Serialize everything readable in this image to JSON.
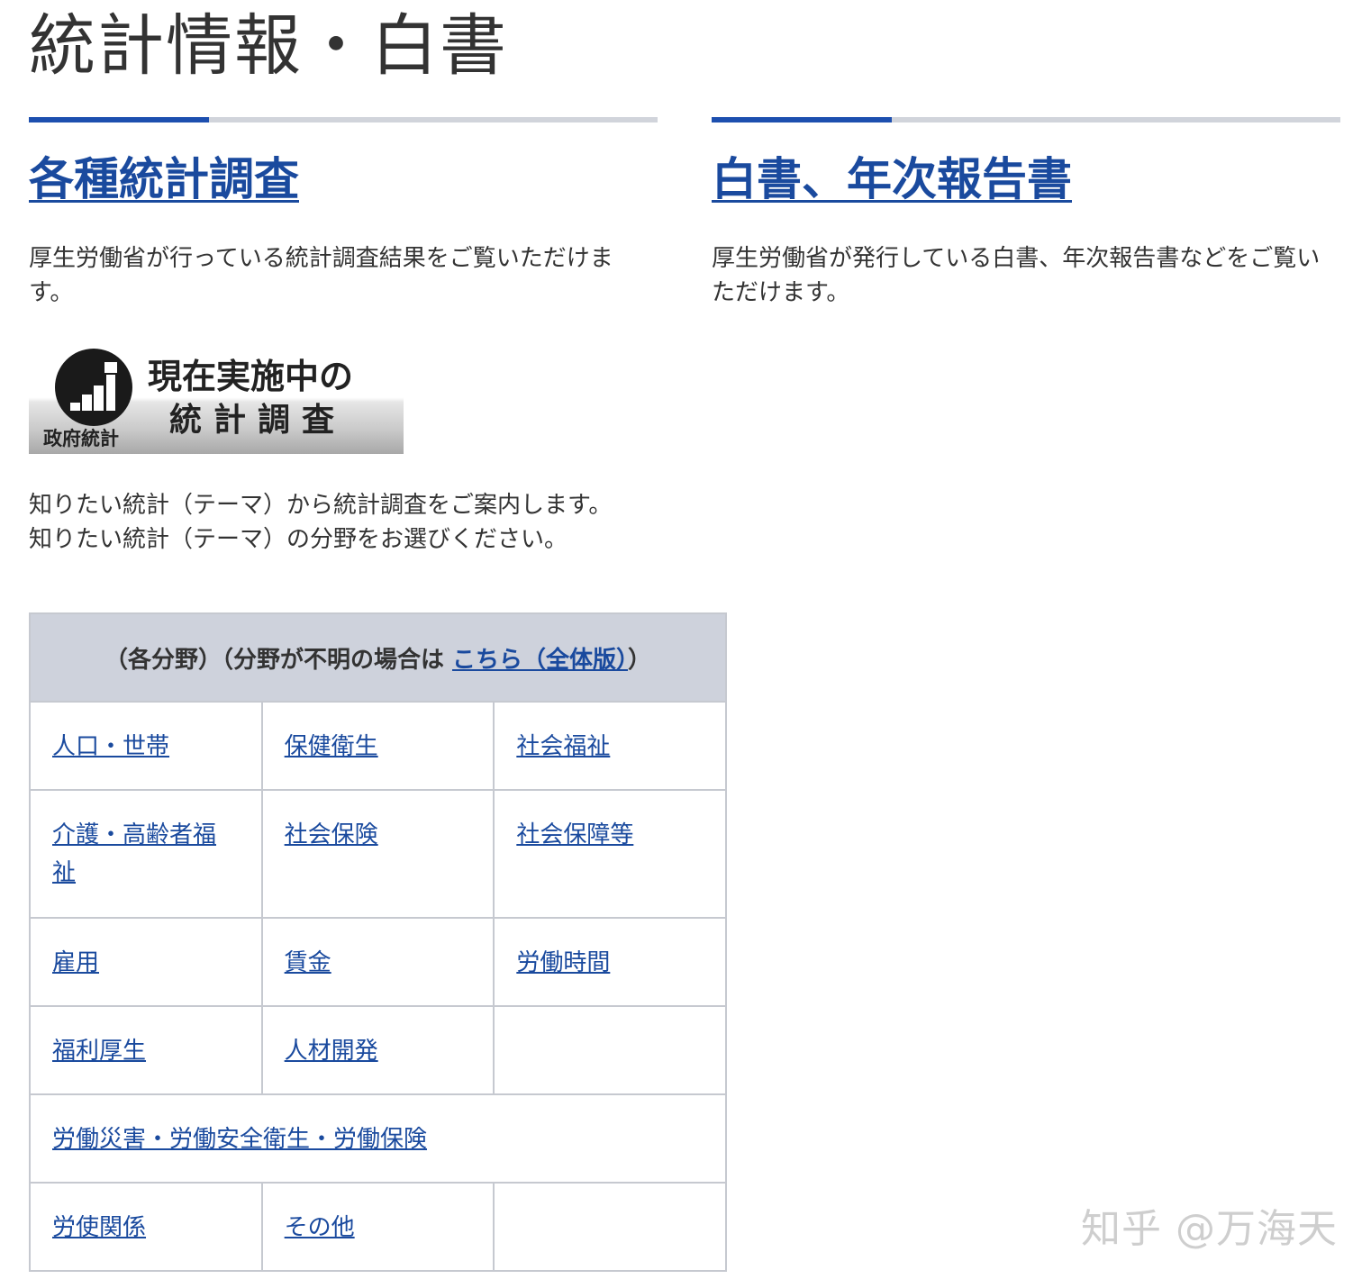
{
  "page": {
    "title": "統計情報・白書"
  },
  "colors": {
    "accent_rule": "#1d4faf",
    "rule": "#d1d4db",
    "link": "#1a4a9e",
    "table_header_bg": "#ced2dc",
    "table_border": "#c6c9d0",
    "text": "#333333"
  },
  "left_section": {
    "heading": "各種統計調査",
    "description": "厚生労働省が行っている統計調査結果をご覧いただけます。"
  },
  "right_section": {
    "heading": "白書、年次報告書",
    "description": "厚生労働省が発行している白書、年次報告書などをご覧いただけます。"
  },
  "banner": {
    "logo_icon": "government-statistics-logo-icon",
    "caption": "政府統計",
    "line1": "現在実施中の",
    "line2": "統計調査"
  },
  "intro": {
    "line1": "知りたい統計（テーマ）から統計調査をご案内します。",
    "line2": "知りたい統計（テーマ）の分野をお選びください。"
  },
  "fields_table": {
    "header_prefix": "（各分野）（分野が不明の場合は ",
    "header_link": "こちら（全体版）",
    "header_suffix": "）",
    "rows": [
      [
        "人口・世帯",
        "保健衛生",
        "社会福祉"
      ],
      [
        "介護・高齢者福祉",
        "社会保険",
        "社会保障等"
      ],
      [
        "雇用",
        "賃金",
        "労働時間"
      ],
      [
        "福利厚生",
        "人材開発",
        ""
      ],
      [
        "労働災害・労働安全衛生・労働保険"
      ],
      [
        "労使関係",
        "その他",
        ""
      ]
    ]
  },
  "watermark": "知乎 @万海天"
}
